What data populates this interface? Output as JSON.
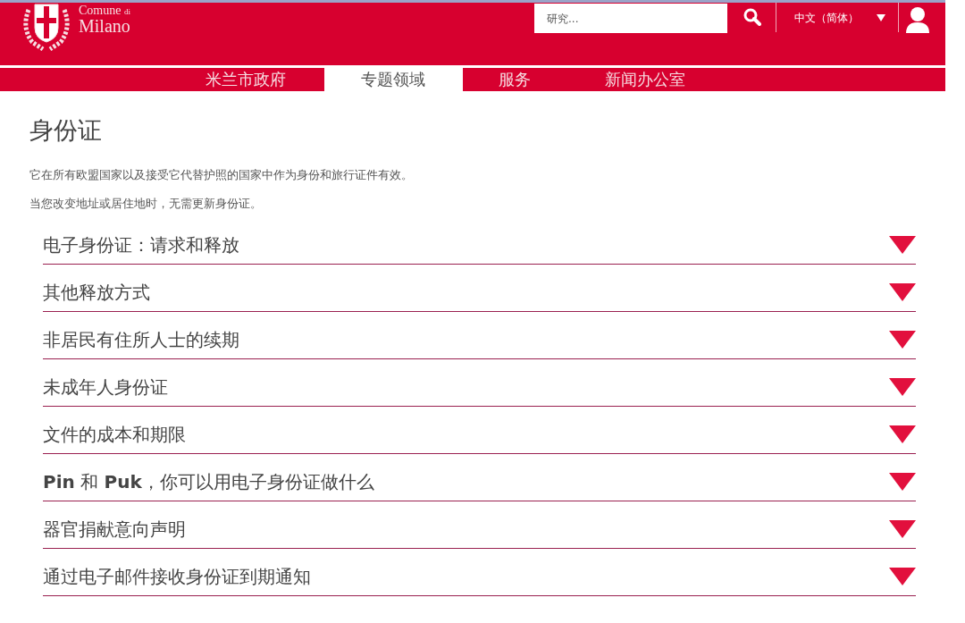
{
  "header": {
    "logo_top": "Comune",
    "logo_small": "di",
    "logo_bottom": "Milano",
    "search": {
      "placeholder": "研究..."
    },
    "language": "中文（简体）"
  },
  "nav": [
    {
      "label": "米兰市政府",
      "selected": false
    },
    {
      "label": "专题领域",
      "selected": true
    },
    {
      "label": "服务",
      "selected": false
    },
    {
      "label": "新闻办公室",
      "selected": false
    }
  ],
  "title": "身份证",
  "paragraphs": [
    "它在所有欧盟国家以及接受它代替护照的国家中作为身份和旅行证件有效。",
    "当您改变地址或居住地时，无需更新身份证。"
  ],
  "accordion": [
    {
      "label": "电子身份证：请求和释放",
      "expanded": false
    },
    {
      "label": "其他释放方式",
      "expanded": false
    },
    {
      "label": "非居民有住所人士的续期",
      "expanded": false
    },
    {
      "label": "未成年人身份证",
      "expanded": false
    },
    {
      "label": "文件的成本和期限",
      "expanded": false
    },
    {
      "label": "**Pin** 和 **Puk**，你可以用电子身份证做什么",
      "expanded": false
    },
    {
      "label": "器官捐献意向声明",
      "expanded": false
    },
    {
      "label": "通过电子邮件接收身份证到期通知",
      "expanded": false
    }
  ]
}
